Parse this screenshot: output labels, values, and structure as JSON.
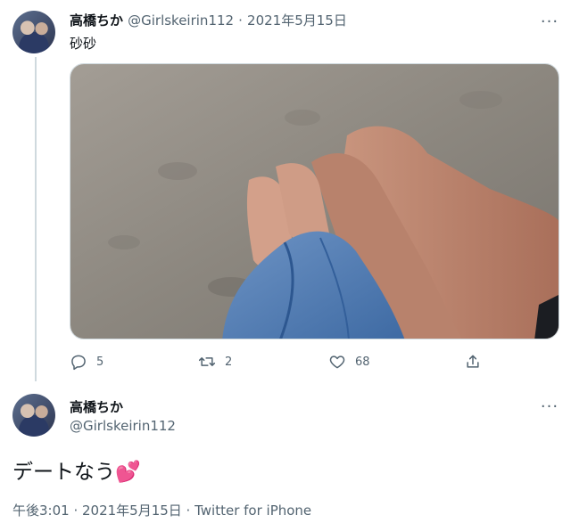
{
  "tweet1": {
    "author_name": "高橋ちか",
    "handle": "@Girlskeirin112",
    "separator": "·",
    "date": "2021年5月15日",
    "text": "砂砂",
    "photo_description_icon": "beach-photo",
    "actions": {
      "reply_count": "5",
      "retweet_count": "2",
      "like_count": "68"
    }
  },
  "tweet2": {
    "author_name": "高橋ちか",
    "handle": "@Girlskeirin112",
    "text": "デートなう",
    "emoji": "💕",
    "timestamp": "午後3:01 · 2021年5月15日 · Twitter for iPhone"
  },
  "colors": {
    "text": "#0f1419",
    "muted": "#536471",
    "border": "#cfd9de",
    "heart": "#e0245e"
  }
}
